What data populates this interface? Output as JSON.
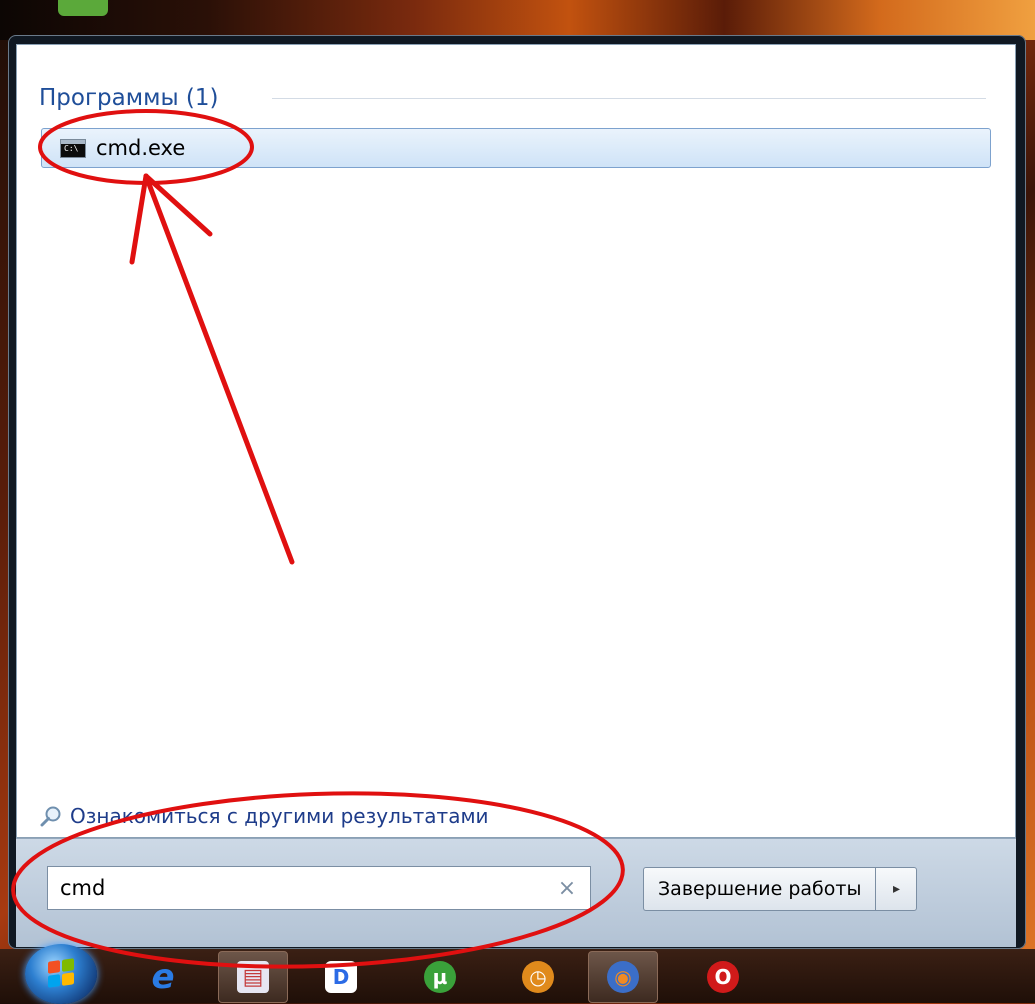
{
  "start_menu": {
    "section_header": "Программы (1)",
    "results": [
      {
        "label": "cmd.exe",
        "icon": "command-prompt-icon"
      }
    ],
    "more_results_label": "Ознакомиться с другими результатами",
    "search": {
      "value": "cmd",
      "clear_icon": "×"
    },
    "shutdown_label": "Завершение работы",
    "shutdown_arrow": "▸"
  },
  "taskbar": {
    "icons": [
      {
        "name": "internet-explorer-icon",
        "glyph": "e",
        "color": "#2a7be4"
      },
      {
        "name": "notepad-app-icon",
        "glyph": "▤",
        "color": "#c43b3b"
      },
      {
        "name": "d-app-icon",
        "glyph": "D",
        "color": "#2b6be6"
      },
      {
        "name": "utorrent-icon",
        "glyph": "µ",
        "color": "#3aa13a"
      },
      {
        "name": "clock-app-icon",
        "glyph": "◷",
        "color": "#e08a1c"
      },
      {
        "name": "firefox-icon",
        "glyph": "◉",
        "color": "#e06a1c"
      },
      {
        "name": "opera-icon",
        "glyph": "O",
        "color": "#d11a1a"
      }
    ]
  },
  "colors": {
    "annotation_red": "#e01010",
    "link_blue": "#1e3c8a",
    "header_blue": "#1f4e99"
  }
}
